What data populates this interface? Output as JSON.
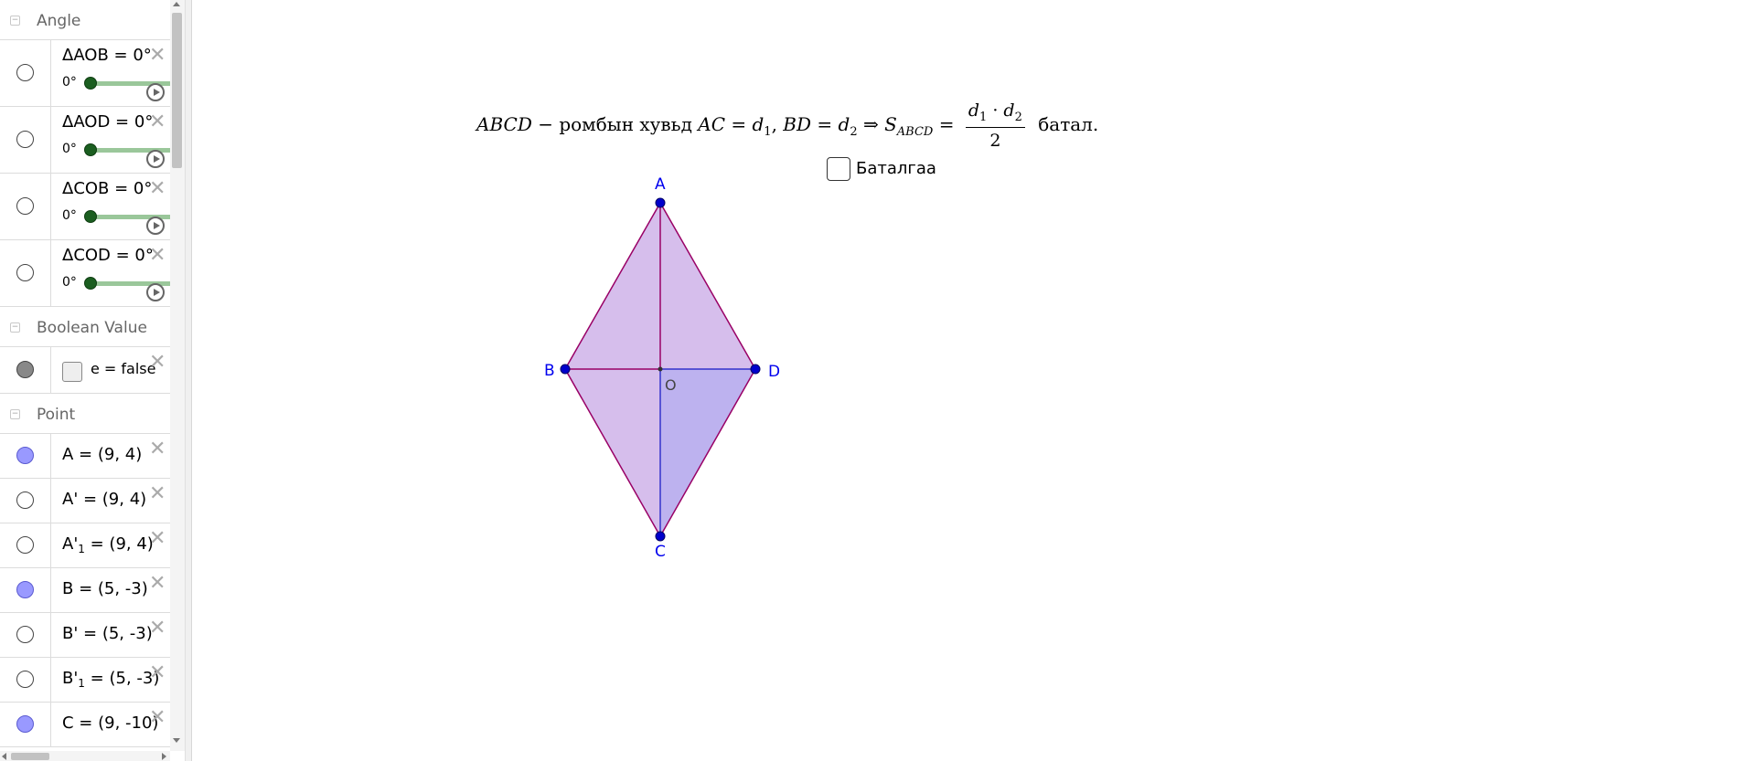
{
  "algebra": {
    "categories": {
      "angle": {
        "label": "Angle"
      },
      "boolean": {
        "label": "Boolean Value"
      },
      "point": {
        "label": "Point"
      }
    },
    "angle_items": [
      {
        "label": "ΔAOB = 0°",
        "slider_value": "0°"
      },
      {
        "label": "ΔAOD = 0°",
        "slider_value": "0°"
      },
      {
        "label": "ΔCOB = 0°",
        "slider_value": "0°"
      },
      {
        "label": "ΔCOD = 0°",
        "slider_value": "0°"
      }
    ],
    "boolean_items": [
      {
        "label": "e = false",
        "checked": false
      }
    ],
    "point_items": [
      {
        "label": "A = (9, 4)",
        "visible": true
      },
      {
        "label": "A' = (9, 4)",
        "visible": false
      },
      {
        "name": "A'",
        "sub": "1",
        "value": " = (9, 4)",
        "visible": false
      },
      {
        "label": "B = (5, -3)",
        "visible": true
      },
      {
        "label": "B' = (5, -3)",
        "visible": false
      },
      {
        "name": "B'",
        "sub": "1",
        "value": " = (5, -3)",
        "visible": false
      },
      {
        "label": "C = (9, -10)",
        "visible": true
      }
    ]
  },
  "graphics": {
    "formula": {
      "lhs": "ABCD",
      "mid_text": " − ромбын хувьд ",
      "ac": "AC",
      "eq": " = ",
      "d": "d",
      "sub1": "1",
      "comma": ", ",
      "bd": "BD",
      "sub2": "2",
      "implies": " ⇒ ",
      "s": "S",
      "s_sub": "ABCD",
      "dot": " · ",
      "den": "2",
      "suffix": " батал."
    },
    "checkbox": {
      "label": "Баталгаа",
      "checked": false
    },
    "points": {
      "A": "A",
      "B": "B",
      "C": "C",
      "D": "D",
      "O": "O"
    },
    "colors": {
      "rhombus_fill": "#c8a8e6",
      "triangle_cod_fill": "#b8b0f0",
      "edge": "#990066",
      "diagonal_ac": "#990066",
      "diagonal_bd": "#3333cc",
      "point": "#0000cc"
    }
  }
}
